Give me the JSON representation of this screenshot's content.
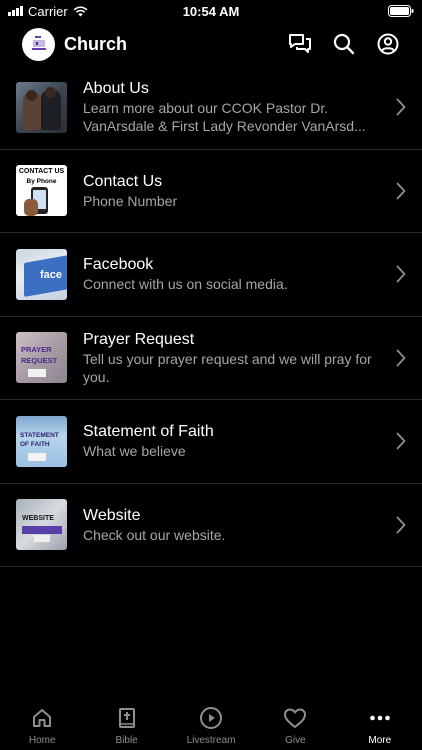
{
  "status_bar": {
    "carrier": "Carrier",
    "time": "10:54 AM"
  },
  "header": {
    "title": "Church"
  },
  "items": [
    {
      "title": "About Us",
      "subtitle": "Learn more about our CCOK Pastor Dr. VanArsdale & First Lady Revonder VanArsd...",
      "thumb": "about-us-thumbnail"
    },
    {
      "title": "Contact Us",
      "subtitle": "Phone Number",
      "thumb": "contact-us-thumbnail",
      "thumb_text": [
        "CONTACT US",
        "By Phone"
      ]
    },
    {
      "title": "Facebook",
      "subtitle": "Connect with us on social media.",
      "thumb": "facebook-thumbnail",
      "thumb_text": [
        "face"
      ]
    },
    {
      "title": "Prayer Request",
      "subtitle": "Tell us your prayer request and we will pray for you.",
      "thumb": "prayer-request-thumbnail",
      "thumb_text": [
        "PRAYER",
        "REQUEST"
      ]
    },
    {
      "title": "Statement of Faith",
      "subtitle": "What we believe",
      "thumb": "statement-of-faith-thumbnail",
      "thumb_text": [
        "STATEMENT",
        "OF FAITH"
      ]
    },
    {
      "title": "Website",
      "subtitle": "Check out our website.",
      "thumb": "website-thumbnail",
      "thumb_text": [
        "WEBSITE"
      ]
    }
  ],
  "tabs": [
    {
      "label": "Home",
      "icon": "home-icon",
      "active": false
    },
    {
      "label": "Bible",
      "icon": "bible-icon",
      "active": false
    },
    {
      "label": "Livestream",
      "icon": "play-circle-icon",
      "active": false
    },
    {
      "label": "Give",
      "icon": "heart-icon",
      "active": false
    },
    {
      "label": "More",
      "icon": "more-icon",
      "active": true
    }
  ],
  "colors": {
    "background": "#000000",
    "text": "#ffffff",
    "subtitle": "#a6a6a6",
    "separator": "#2a2a2a",
    "tab_inactive": "#8e8e93"
  }
}
